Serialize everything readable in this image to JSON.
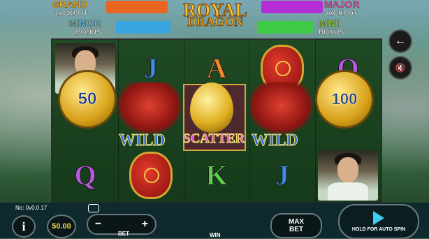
{
  "jackpots": {
    "grand": {
      "name": "GRAND",
      "sub": "JACKPOT"
    },
    "minor": {
      "name": "MINOR",
      "sub": "BONUS"
    },
    "major": {
      "name": "MAJOR",
      "sub": "JACKPOT"
    },
    "mini": {
      "name": "MINI",
      "sub": "BONUS"
    }
  },
  "logo": {
    "line1": "ROYAL",
    "line2": "DRAGON"
  },
  "reels": {
    "col2_top": "J",
    "col3_top": "A",
    "col5_top": "Q",
    "col1_bottom": "Q",
    "col3_bottom": "K",
    "col4_bottom": "J",
    "coin_left": "50",
    "coin_right": "100",
    "wild_left": "WILD",
    "scatter": "SCATTER",
    "wild_right": "WILD"
  },
  "controls": {
    "version": "No: 0v0.0.17",
    "info_icon": "i",
    "bet_value": "50.00",
    "minus": "−",
    "plus": "+",
    "bet_label": "BET",
    "win_label": "WIN",
    "max_bet_line1": "MAX",
    "max_bet_line2": "BET",
    "spin_label": "HOLD FOR AUTO SPIN",
    "back_icon": "arrow-left-icon",
    "sound_icon": "mute-icon"
  },
  "colors": {
    "grand_bar": "#e8661f",
    "major_bar": "#b52dd6",
    "minor_bar": "#37a6e0",
    "mini_bar": "#3ecb45"
  }
}
